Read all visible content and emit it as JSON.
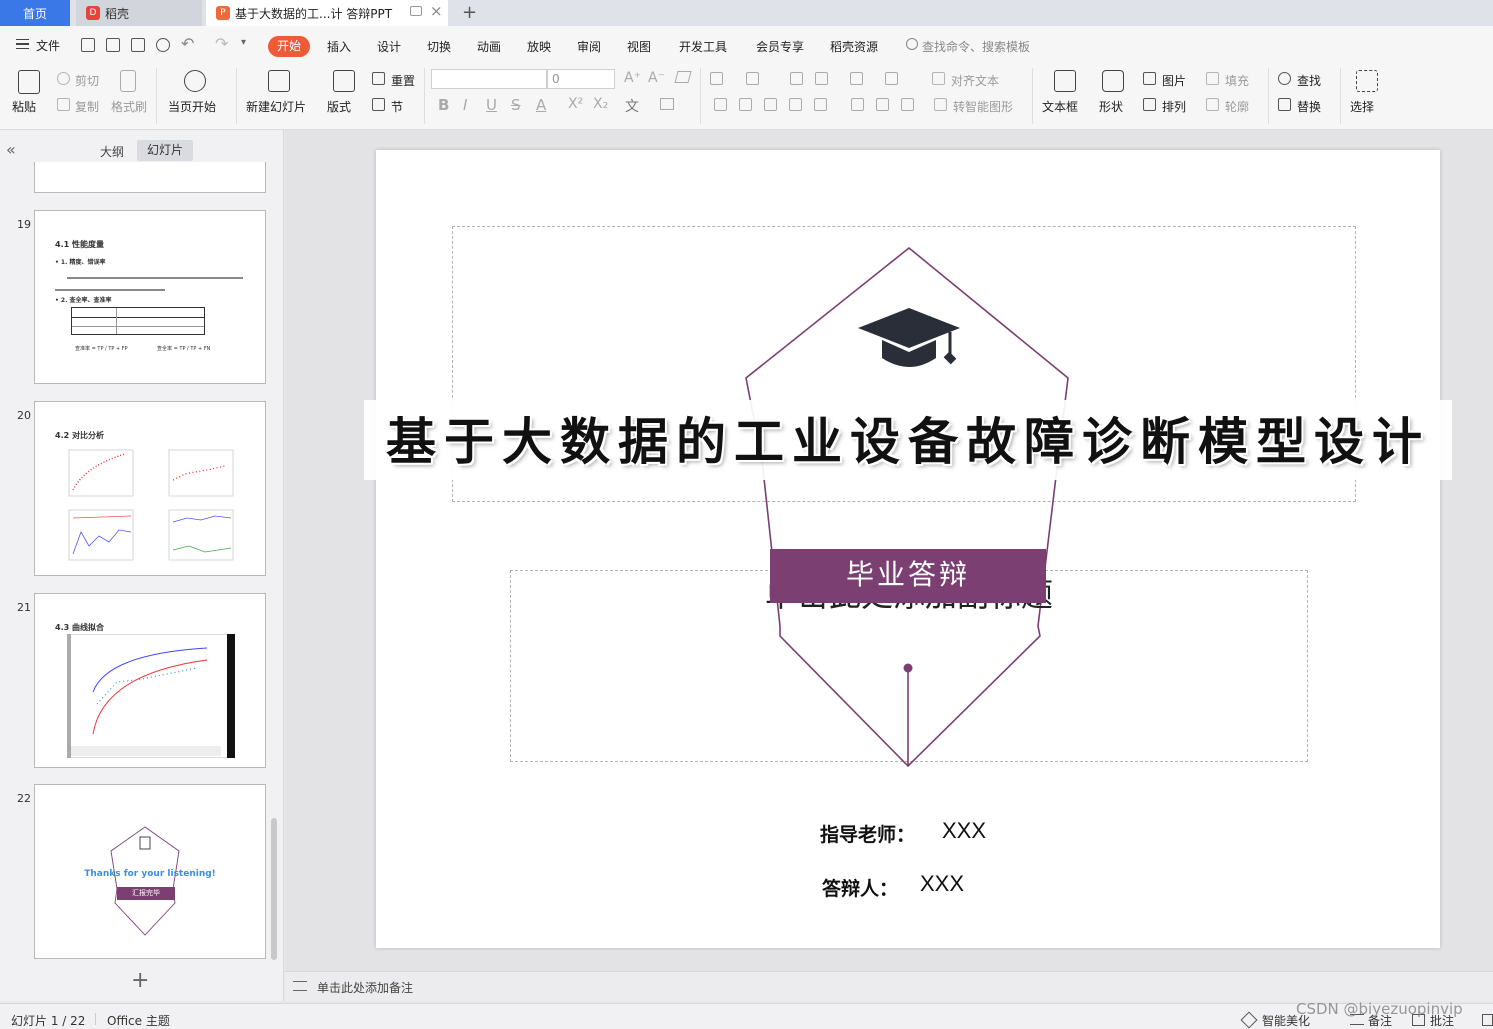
{
  "tabs": {
    "home": "首页",
    "docer": "稻壳",
    "document": "基于大数据的工...计 答辩PPT"
  },
  "menu": {
    "file": "文件",
    "items": [
      "开始",
      "插入",
      "设计",
      "切换",
      "动画",
      "放映",
      "审阅",
      "视图",
      "开发工具",
      "会员专享",
      "稻壳资源"
    ],
    "search_placeholder": "查找命令、搜索模板"
  },
  "ribbon": {
    "paste": "粘贴",
    "cut": "剪切",
    "copy": "复制",
    "format_painter": "格式刷",
    "from_current": "当页开始",
    "new_slide": "新建幻灯片",
    "layout": "版式",
    "reset": "重置",
    "section": "节",
    "font_size": "0",
    "align_text": "对齐文本",
    "smart_shape": "转智能图形",
    "textbox": "文本框",
    "shape": "形状",
    "picture": "图片",
    "arrange": "排列",
    "fill": "填充",
    "outline": "轮廓",
    "find": "查找",
    "replace": "替换",
    "select": "选择"
  },
  "left_panel": {
    "tab_outline": "大纲",
    "tab_slides": "幻灯片",
    "slides": [
      {
        "num": "19",
        "title": "4.1 性能度量",
        "b1": "• 1. 精度、错误率",
        "b2": "• 2. 查全率、查准率",
        "f1": "查准率",
        "f2": "查全率",
        "frac1": "TP + FP",
        "frac2": "TP + FN"
      },
      {
        "num": "20",
        "title": "4.2 对比分析"
      },
      {
        "num": "21",
        "title": "4.3 曲线拟合"
      },
      {
        "num": "22",
        "thanks": "Thanks for your listening!",
        "banner": "汇报完毕"
      }
    ]
  },
  "slide": {
    "title": "基于大数据的工业设备故障诊断模型设计",
    "subtitle_placeholder": "单击此处添加副标题",
    "banner": "毕业答辩",
    "advisor_label": "指导老师：",
    "advisor_value": "XXX",
    "presenter_label": "答辩人：",
    "presenter_value": "XXX"
  },
  "notes": {
    "placeholder": "单击此处添加备注"
  },
  "status": {
    "slide_count": "幻灯片 1 / 22",
    "theme": "Office 主题",
    "beautify": "智能美化",
    "notes": "备注",
    "comments": "批注",
    "watermark": "CSDN @biyezuopinvip"
  },
  "colors": {
    "accent_purple": "#7b3f72",
    "start_button": "#ef5b39",
    "home_tab": "#3b78e7",
    "thanks_blue": "#3a8ee6"
  }
}
